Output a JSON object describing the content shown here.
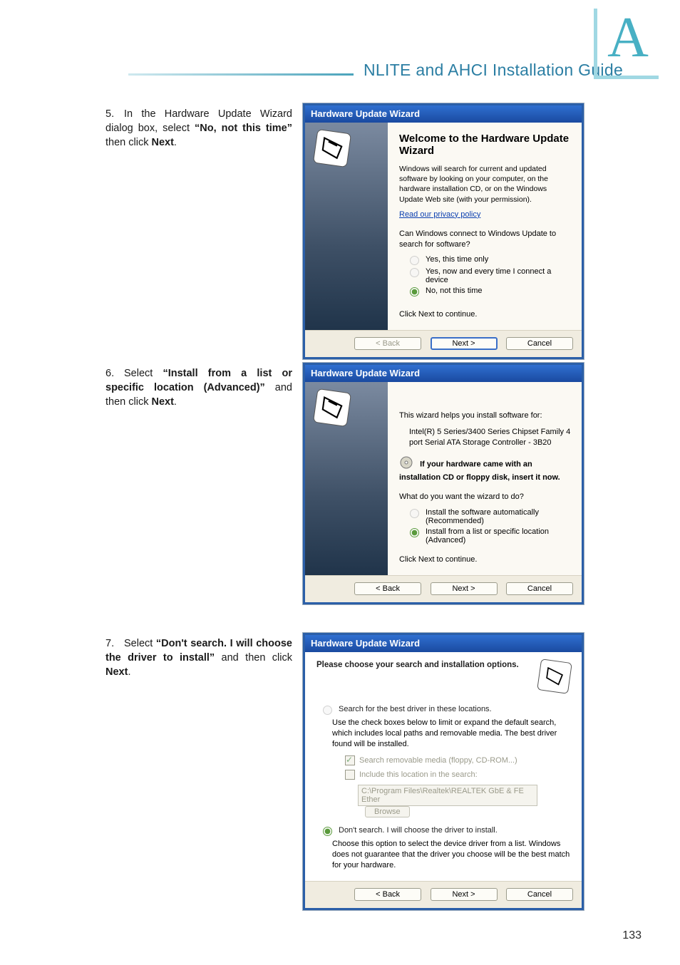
{
  "header": {
    "title": "NLITE and AHCI Installation Guide",
    "appendix_glyph": "A"
  },
  "steps": {
    "s5": {
      "num": "5.",
      "pre": "In the Hardware Update Wizard dialog box, select ",
      "bold": "“No, not this time”",
      "mid": " then click ",
      "bold2": "Next",
      "post": "."
    },
    "s6": {
      "num": "6.",
      "pre": "Select ",
      "bold": "“Install from a list or specific location (Advanced)”",
      "mid": " and then click ",
      "bold2": "Next",
      "post": "."
    },
    "s7": {
      "num": "7.",
      "pre": "Select ",
      "bold": "“Don't search. I will choose the driver to install”",
      "mid": " and then click ",
      "bold2": "Next",
      "post": "."
    }
  },
  "wiz1": {
    "title": "Hardware Update Wizard",
    "heading": "Welcome to the Hardware Update Wizard",
    "intro": "Windows will search for current and updated software by looking on your computer, on the hardware installation CD, or on the Windows Update Web site (with your permission).",
    "privacy": "Read our privacy policy",
    "q": "Can Windows connect to Windows Update to search for software?",
    "opts": [
      "Yes, this time only",
      "Yes, now and every time I connect a device",
      "No, not this time"
    ],
    "cont": "Click Next to continue.",
    "back": "< Back",
    "next": "Next >",
    "cancel": "Cancel"
  },
  "wiz2": {
    "title": "Hardware Update Wizard",
    "intro": "This wizard helps you install software for:",
    "device": "Intel(R) 5 Series/3400 Series Chipset Family 4 port Serial ATA Storage Controller - 3B20",
    "tip": "If your hardware came with an installation CD or floppy disk, insert it now.",
    "q": "What do you want the wizard to do?",
    "opts": [
      "Install the software automatically (Recommended)",
      "Install from a list or specific location (Advanced)"
    ],
    "cont": "Click Next to continue.",
    "back": "< Back",
    "next": "Next >",
    "cancel": "Cancel"
  },
  "wiz3": {
    "title": "Hardware Update Wizard",
    "heading": "Please choose your search and installation options.",
    "opt1": "Search for the best driver in these locations.",
    "opt1_desc": "Use the check boxes below to limit or expand the default search, which includes local paths and removable media. The best driver found will be installed.",
    "cb1": "Search removable media (floppy, CD-ROM...)",
    "cb2": "Include this location in the search:",
    "path": "C:\\Program Files\\Realtek\\REALTEK GbE & FE Ether",
    "browse": "Browse",
    "opt2": "Don't search. I will choose the driver to install.",
    "opt2_desc": "Choose this option to select the device driver from a list.  Windows does not guarantee that the driver you choose will be the best match for your hardware.",
    "back": "< Back",
    "next": "Next >",
    "cancel": "Cancel"
  },
  "page_number": "133"
}
